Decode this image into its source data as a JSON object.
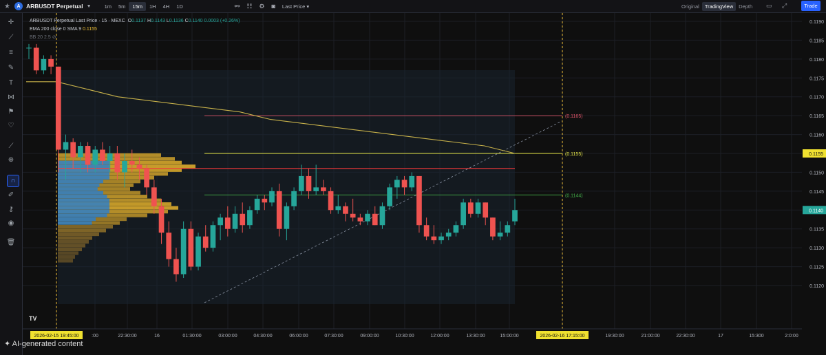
{
  "header": {
    "symbol": "ARBUSDT Perpetual",
    "timeframes": [
      "1m",
      "5m",
      "15m",
      "1H",
      "4H",
      "1D"
    ],
    "active_timeframe": "15m",
    "price_type": "Last Price",
    "views": [
      "Original",
      "TradingView",
      "Depth"
    ],
    "active_view": "TradingView",
    "trade_button": "Trade"
  },
  "legend": {
    "title": "ARBUSDT Perpetual Last Price · 15 · MEXC",
    "open_label": "O",
    "open": "0.1137",
    "high_label": "H",
    "high": "0.1143",
    "low_label": "L",
    "low": "0.1136",
    "close_label": "C",
    "close": "0.1140",
    "change": "0.0003 (+0.26%)",
    "ema_label": "EMA 200 close 0 SMA 9",
    "ema_value": "0.1155",
    "bb_label": "BB 20 2.5"
  },
  "chart_data": {
    "type": "candlestick",
    "y_ticks": [
      "0.1190",
      "0.1185",
      "0.1180",
      "0.1175",
      "0.1170",
      "0.1165",
      "0.1160",
      "0.1155",
      "0.1150",
      "0.1145",
      "0.1140",
      "0.1135",
      "0.1130",
      "0.1125",
      "0.1120"
    ],
    "ylim": [
      0.1118,
      0.1192
    ],
    "x_tick_labels": [
      "2026-02-15  19:45:00",
      ":00",
      "22:30:00",
      "16",
      "01:30:00",
      "03:00:00",
      "04:30:00",
      "06:00:00",
      "07:30:00",
      "09:00:00",
      "10:30:00",
      "12:00:00",
      "13:30:00",
      "15:00:00",
      "2026-02-16  17:15:00",
      "19:30:00",
      "21:00:00",
      "22:30:00",
      "17",
      "15:300",
      "2:0:00"
    ],
    "price_badges": [
      {
        "value": "0.1155",
        "color": "#f0e130"
      },
      {
        "value": "0.1140",
        "color": "#26a69a"
      }
    ],
    "horizontal_levels": [
      {
        "label": "(0.1165)",
        "value": 0.1165,
        "color": "#e0556a"
      },
      {
        "label": "(0.1155)",
        "value": 0.1155,
        "color": "#e8e84a"
      },
      {
        "label": "(0.1144)",
        "value": 0.1144,
        "color": "#43b049"
      },
      {
        "label": "",
        "value": 0.1151,
        "color": "#ff3b3b"
      }
    ],
    "ema_series": [
      0.1174,
      0.1174,
      0.1172,
      0.117,
      0.1169,
      0.1168,
      0.1167,
      0.1166,
      0.1164,
      0.1163,
      0.1162,
      0.1161,
      0.116,
      0.1159,
      0.1158,
      0.1157,
      0.1155
    ],
    "candles": [
      [
        0.1183,
        0.1184,
        0.118,
        0.1183
      ],
      [
        0.1183,
        0.1184,
        0.1176,
        0.1177
      ],
      [
        0.1177,
        0.1181,
        0.1176,
        0.118
      ],
      [
        0.118,
        0.1181,
        0.1176,
        0.1178
      ],
      [
        0.1178,
        0.1178,
        0.115,
        0.1156
      ],
      [
        0.1156,
        0.116,
        0.1148,
        0.1158
      ],
      [
        0.1158,
        0.1159,
        0.1151,
        0.1154
      ],
      [
        0.1154,
        0.1158,
        0.115,
        0.1157
      ],
      [
        0.1157,
        0.1158,
        0.115,
        0.1152
      ],
      [
        0.1152,
        0.1157,
        0.115,
        0.1156
      ],
      [
        0.1156,
        0.1158,
        0.1152,
        0.1153
      ],
      [
        0.1153,
        0.1157,
        0.115,
        0.1155
      ],
      [
        0.1155,
        0.1157,
        0.1148,
        0.115
      ],
      [
        0.115,
        0.1155,
        0.1146,
        0.1153
      ],
      [
        0.1153,
        0.1156,
        0.115,
        0.1152
      ],
      [
        0.1152,
        0.1154,
        0.1148,
        0.1151
      ],
      [
        0.1151,
        0.1152,
        0.1144,
        0.1146
      ],
      [
        0.1146,
        0.1148,
        0.1139,
        0.1141
      ],
      [
        0.1141,
        0.1143,
        0.1131,
        0.1134
      ],
      [
        0.1134,
        0.1137,
        0.1125,
        0.1127
      ],
      [
        0.1127,
        0.113,
        0.1121,
        0.1123
      ],
      [
        0.1123,
        0.1137,
        0.1122,
        0.1135
      ],
      [
        0.1135,
        0.1137,
        0.1124,
        0.1125
      ],
      [
        0.1125,
        0.1134,
        0.1124,
        0.1133
      ],
      [
        0.1133,
        0.1136,
        0.1129,
        0.113
      ],
      [
        0.113,
        0.1137,
        0.1129,
        0.1136
      ],
      [
        0.1136,
        0.1139,
        0.1132,
        0.1138
      ],
      [
        0.1138,
        0.1141,
        0.1133,
        0.1135
      ],
      [
        0.1135,
        0.1141,
        0.1134,
        0.1139
      ],
      [
        0.1139,
        0.1142,
        0.1134,
        0.1136
      ],
      [
        0.1136,
        0.1141,
        0.1135,
        0.114
      ],
      [
        0.114,
        0.1144,
        0.1139,
        0.1143
      ],
      [
        0.1143,
        0.1144,
        0.114,
        0.1142
      ],
      [
        0.1142,
        0.1146,
        0.1141,
        0.1145
      ],
      [
        0.1145,
        0.1147,
        0.1133,
        0.1135
      ],
      [
        0.1135,
        0.1142,
        0.1132,
        0.1141
      ],
      [
        0.1141,
        0.1146,
        0.114,
        0.1145
      ],
      [
        0.1145,
        0.1152,
        0.1144,
        0.1149
      ],
      [
        0.1149,
        0.1151,
        0.1143,
        0.1145
      ],
      [
        0.1145,
        0.1152,
        0.1144,
        0.1146
      ],
      [
        0.1146,
        0.1148,
        0.1144,
        0.1145
      ],
      [
        0.1145,
        0.1146,
        0.1139,
        0.114
      ],
      [
        0.114,
        0.1144,
        0.1139,
        0.1141
      ],
      [
        0.1141,
        0.1142,
        0.1137,
        0.1139
      ],
      [
        0.1139,
        0.1143,
        0.1137,
        0.1138
      ],
      [
        0.1138,
        0.1139,
        0.1136,
        0.1137
      ],
      [
        0.1137,
        0.114,
        0.1136,
        0.1139
      ],
      [
        0.1139,
        0.1141,
        0.1136,
        0.1136
      ],
      [
        0.1136,
        0.1142,
        0.1135,
        0.1141
      ],
      [
        0.1141,
        0.1147,
        0.114,
        0.1146
      ],
      [
        0.1146,
        0.1149,
        0.1143,
        0.1148
      ],
      [
        0.1148,
        0.1149,
        0.1144,
        0.1146
      ],
      [
        0.1146,
        0.115,
        0.1145,
        0.1149
      ],
      [
        0.1149,
        0.1149,
        0.1134,
        0.1136
      ],
      [
        0.1136,
        0.1138,
        0.1132,
        0.1133
      ],
      [
        0.1133,
        0.1136,
        0.1131,
        0.1132
      ],
      [
        0.1132,
        0.1134,
        0.1131,
        0.1133
      ],
      [
        0.1133,
        0.1135,
        0.1132,
        0.1134
      ],
      [
        0.1134,
        0.1137,
        0.1133,
        0.1136
      ],
      [
        0.1136,
        0.1143,
        0.1135,
        0.1142
      ],
      [
        0.1142,
        0.1143,
        0.1138,
        0.1139
      ],
      [
        0.1139,
        0.1143,
        0.1138,
        0.1142
      ],
      [
        0.1142,
        0.1142,
        0.1136,
        0.1138
      ],
      [
        0.1138,
        0.1138,
        0.1132,
        0.1133
      ],
      [
        0.1133,
        0.1137,
        0.1132,
        0.1134
      ],
      [
        0.1134,
        0.1137,
        0.1133,
        0.1136
      ],
      [
        0.1137,
        0.1143,
        0.1136,
        0.114
      ]
    ]
  }
}
